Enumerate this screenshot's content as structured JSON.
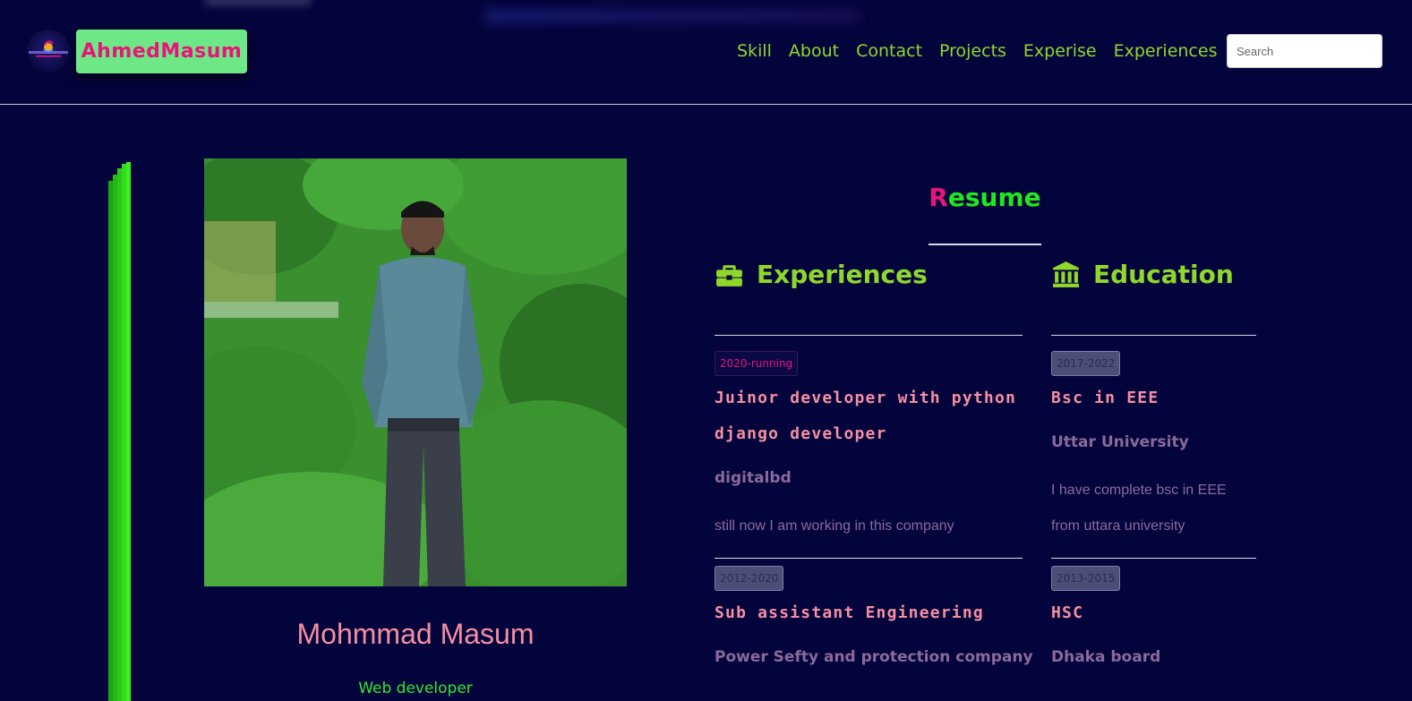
{
  "header": {
    "brand": "AhmedMasum",
    "nav": [
      "Skill",
      "About",
      "Contact",
      "Projects",
      "Experise",
      "Experiences"
    ],
    "search_placeholder": "Search"
  },
  "profile": {
    "name": "Mohmmad Masum",
    "role": "Web developer"
  },
  "resume": {
    "title_first": "R",
    "title_rest": "esume",
    "experiences_heading": "Experiences",
    "education_heading": "Education",
    "experiences": [
      {
        "period": "2020-running",
        "title": "Juinor developer with python django developer",
        "org": "digitalbd",
        "desc": "still now I am working in this company"
      },
      {
        "period": "2012-2020",
        "title": "Sub assistant Engineering",
        "org": "Power Sefty and protection company"
      }
    ],
    "education": [
      {
        "period": "2017-2022",
        "title": "Bsc in EEE",
        "org": "Uttar University",
        "desc": "I have complete bsc in EEE from uttara university"
      },
      {
        "period": "2013-2015",
        "title": "HSC",
        "org": "Dhaka board"
      }
    ]
  },
  "colors": {
    "background": "#04043d",
    "accent_green": "#8fd82a",
    "pink": "#e8147a",
    "salmon": "#f58fa0"
  }
}
